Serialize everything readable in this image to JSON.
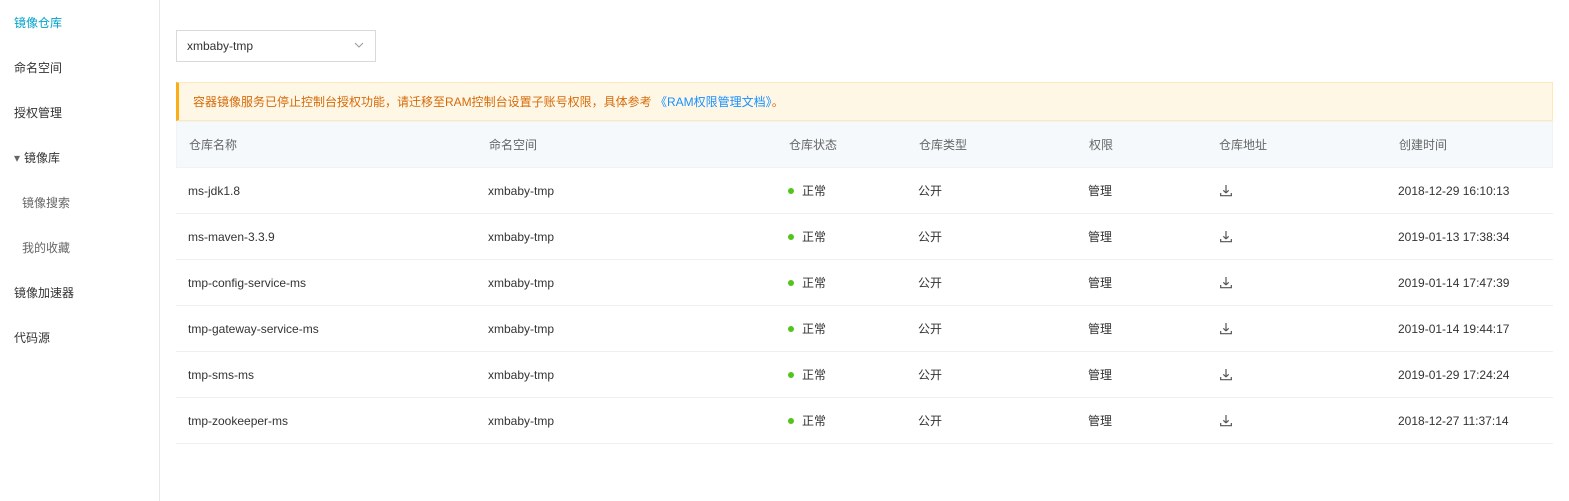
{
  "sidebar": {
    "items": [
      {
        "label": "镜像仓库",
        "active": true
      },
      {
        "label": "命名空间"
      },
      {
        "label": "授权管理"
      },
      {
        "label": "镜像库",
        "hasCaret": true
      },
      {
        "label": "镜像搜索",
        "sub": true
      },
      {
        "label": "我的收藏",
        "sub": true
      },
      {
        "label": "镜像加速器"
      },
      {
        "label": "代码源"
      }
    ]
  },
  "selector": {
    "value": "xmbaby-tmp"
  },
  "notice": {
    "text_before": "容器镜像服务已停止控制台授权功能，请迁移至RAM控制台设置子账号权限，具体参考 ",
    "link_text": "《RAM权限管理文档》",
    "text_after": "。"
  },
  "table": {
    "headers": {
      "name": "仓库名称",
      "namespace": "命名空间",
      "status": "仓库状态",
      "type": "仓库类型",
      "permission": "权限",
      "address": "仓库地址",
      "created": "创建时间"
    },
    "rows": [
      {
        "name": "ms-jdk1.8",
        "namespace": "xmbaby-tmp",
        "status": "正常",
        "type": "公开",
        "permission": "管理",
        "created": "2018-12-29 16:10:13"
      },
      {
        "name": "ms-maven-3.3.9",
        "namespace": "xmbaby-tmp",
        "status": "正常",
        "type": "公开",
        "permission": "管理",
        "created": "2019-01-13 17:38:34"
      },
      {
        "name": "tmp-config-service-ms",
        "namespace": "xmbaby-tmp",
        "status": "正常",
        "type": "公开",
        "permission": "管理",
        "created": "2019-01-14 17:47:39"
      },
      {
        "name": "tmp-gateway-service-ms",
        "namespace": "xmbaby-tmp",
        "status": "正常",
        "type": "公开",
        "permission": "管理",
        "created": "2019-01-14 19:44:17"
      },
      {
        "name": "tmp-sms-ms",
        "namespace": "xmbaby-tmp",
        "status": "正常",
        "type": "公开",
        "permission": "管理",
        "created": "2019-01-29 17:24:24"
      },
      {
        "name": "tmp-zookeeper-ms",
        "namespace": "xmbaby-tmp",
        "status": "正常",
        "type": "公开",
        "permission": "管理",
        "created": "2018-12-27 11:37:14"
      }
    ]
  }
}
